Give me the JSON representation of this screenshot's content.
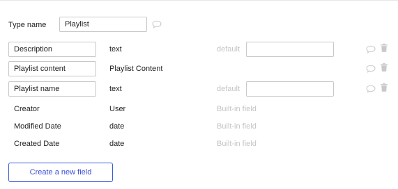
{
  "type": {
    "label": "Type name",
    "value": "Playlist"
  },
  "fields": [
    {
      "name": "Description",
      "type": "text",
      "default_label": "default",
      "default_value": ""
    },
    {
      "name": "Playlist content",
      "type": "Playlist Content"
    },
    {
      "name": "Playlist name",
      "type": "text",
      "default_label": "default",
      "default_value": ""
    }
  ],
  "builtin_fields": [
    {
      "name": "Creator",
      "type": "User",
      "label": "Built-in field"
    },
    {
      "name": "Modified Date",
      "type": "date",
      "label": "Built-in field"
    },
    {
      "name": "Created Date",
      "type": "date",
      "label": "Built-in field"
    }
  ],
  "actions": {
    "create_label": "Create a new field"
  },
  "icons": {
    "comment": "comment-icon",
    "trash": "trash-icon"
  },
  "colors": {
    "accent": "#3b4fd6",
    "muted_text": "#c4c4c4",
    "border": "#c8c8c8",
    "icon": "#c9c9c9"
  }
}
